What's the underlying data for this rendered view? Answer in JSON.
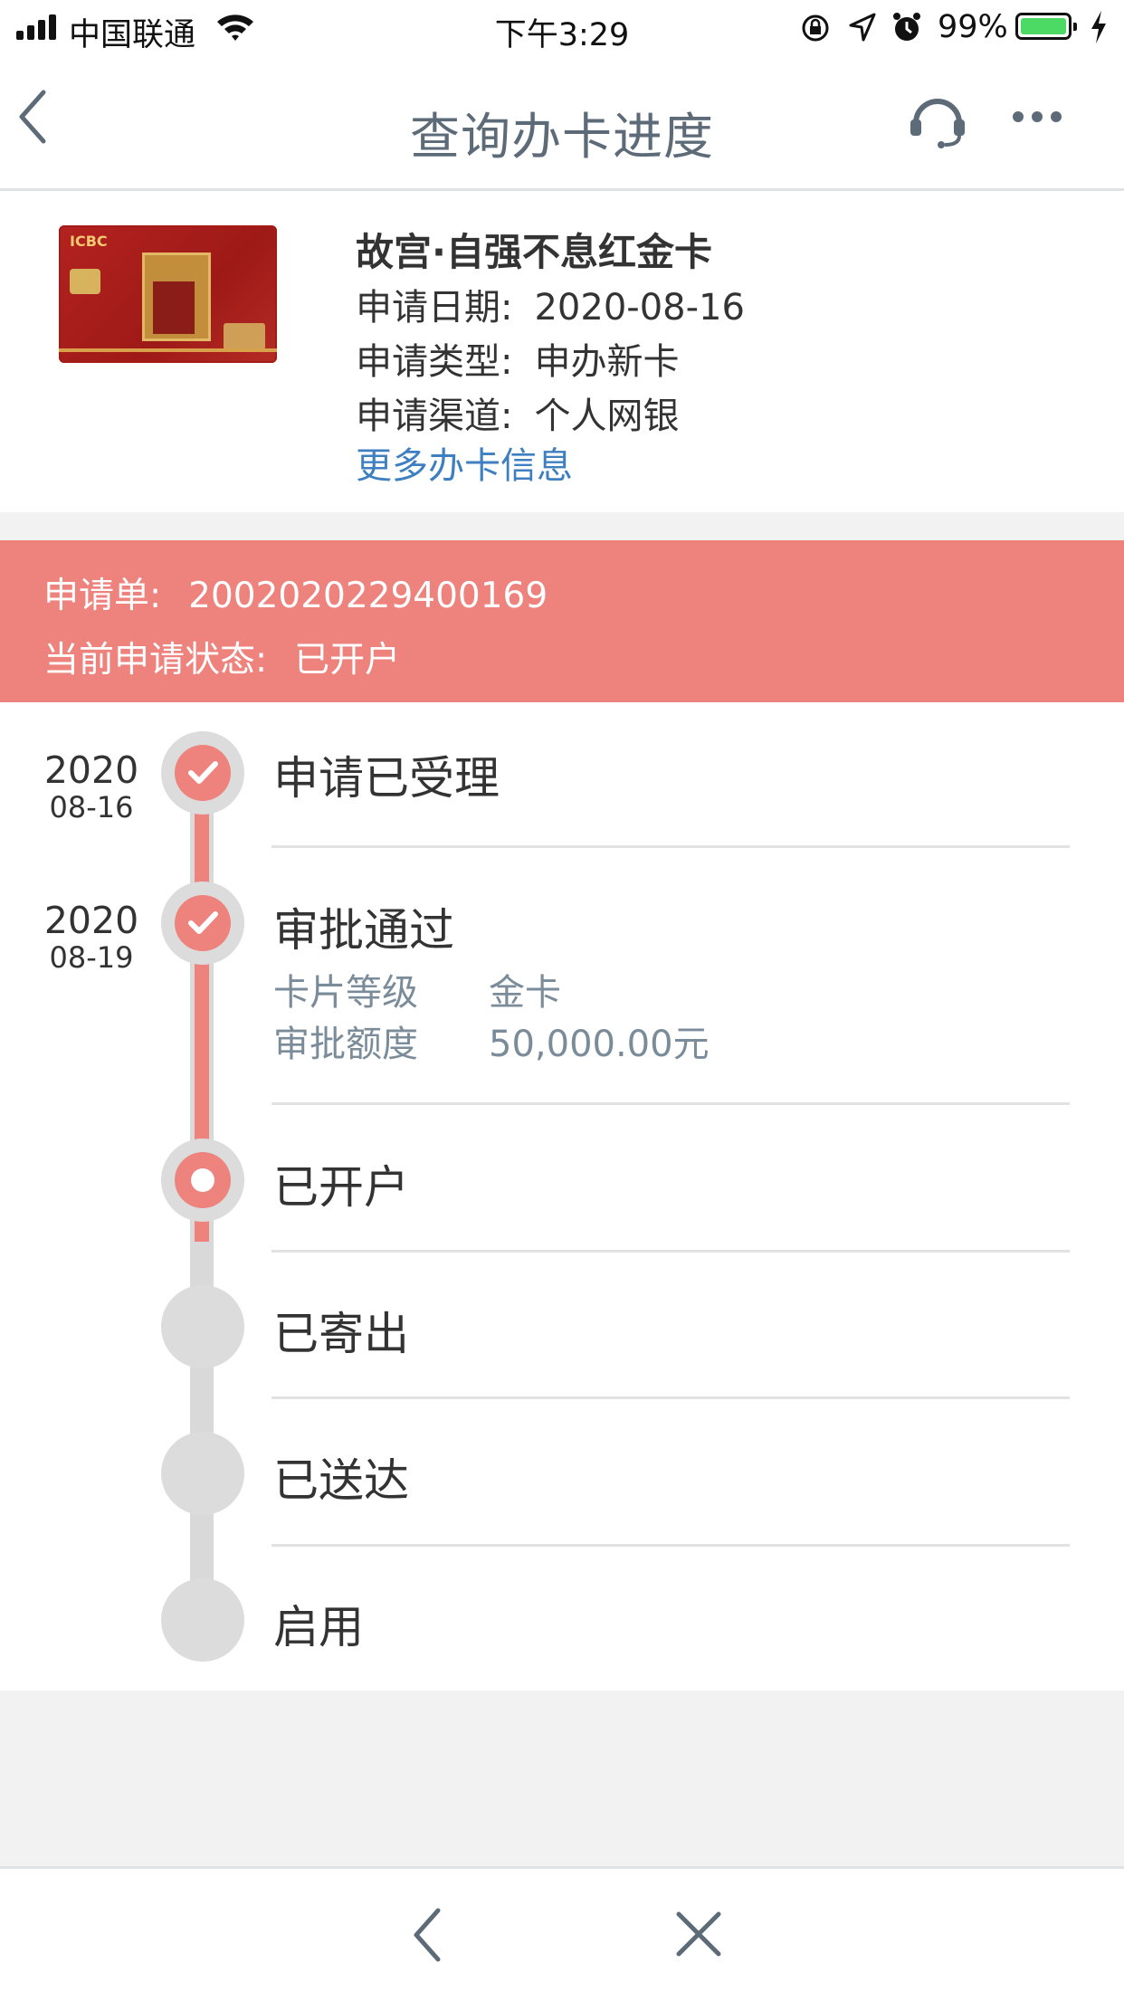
{
  "status_bar": {
    "carrier": "中国联通",
    "time": "下午3:29",
    "battery_percent": "99%",
    "battery_level": 0.99
  },
  "nav": {
    "title": "查询办卡进度",
    "back_icon": "chevron-left-icon",
    "service_icon": "headset-icon",
    "more_icon": "more-horizontal-icon"
  },
  "card": {
    "name": "故宫·自强不息红金卡",
    "rows": [
      {
        "label": "申请日期:",
        "value": "2020-08-16"
      },
      {
        "label": "申请类型:",
        "value": "申办新卡"
      },
      {
        "label": "申请渠道:",
        "value": "个人网银"
      }
    ],
    "more_link": "更多办卡信息",
    "logo_text": "ICBC"
  },
  "application": {
    "number_label": "申请单:",
    "number": "2002020229400169",
    "status_label": "当前申请状态:",
    "status": "已开户"
  },
  "timeline": {
    "steps": [
      {
        "title": "申请已受理",
        "year": "2020",
        "date": "08-16",
        "state": "done"
      },
      {
        "title": "审批通过",
        "year": "2020",
        "date": "08-19",
        "state": "done",
        "details": [
          {
            "label": "卡片等级",
            "value": "金卡"
          },
          {
            "label": "审批额度",
            "value": "50,000.00元"
          }
        ]
      },
      {
        "title": "已开户",
        "state": "current"
      },
      {
        "title": "已寄出",
        "state": "pending"
      },
      {
        "title": "已送达",
        "state": "pending"
      },
      {
        "title": "启用",
        "state": "pending"
      }
    ]
  },
  "bottom_bar": {
    "back_icon": "chevron-left-icon",
    "close_icon": "close-icon"
  },
  "colors": {
    "accent": "#ee827d",
    "link": "#3d7fc0",
    "nav_title": "#5d6b78",
    "pending_gray": "#d9d9d9"
  }
}
